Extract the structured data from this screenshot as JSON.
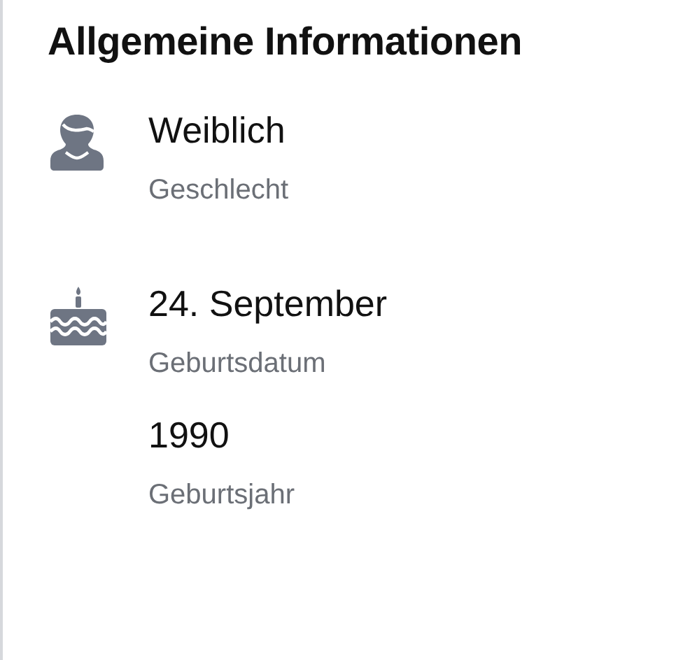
{
  "section": {
    "title": "Allgemeine Informationen"
  },
  "items": [
    {
      "kind": "gender",
      "value": "Weiblich",
      "label": "Geschlecht"
    },
    {
      "kind": "birthday",
      "value": "24. September",
      "label": "Geburtsdatum"
    },
    {
      "kind": "year",
      "value": "1990",
      "label": "Geburtsjahr"
    }
  ]
}
